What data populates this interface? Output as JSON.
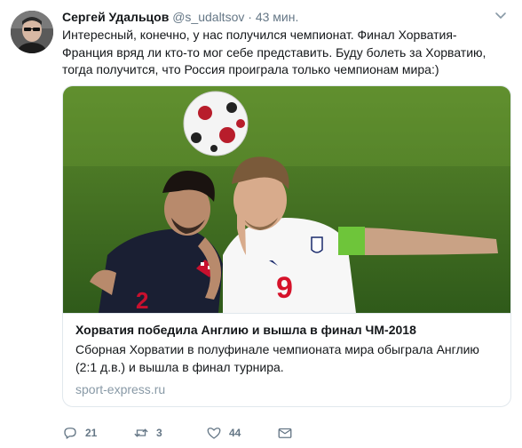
{
  "tweet": {
    "author_name": "Сергей Удальцов",
    "handle": "@s_udaltsov",
    "separator": "·",
    "time": "43 мин.",
    "text": "Интересный, конечно, у нас получился чемпионат. Финал Хорватия-Франция вряд ли кто-то мог себе представить. Буду болеть за Хорватию, тогда получится, что Россия проиграла только чемпионам мира:)"
  },
  "card": {
    "title": "Хорватия победила Англию и вышла в финал ЧМ-2018",
    "description": "Сборная Хорватии в полуфинале чемпионата мира обыграла Англию (2:1 д.в.) и вышла в финал турнира.",
    "domain": "sport-express.ru",
    "image_jersey_number": "9"
  },
  "actions": {
    "reply_count": "21",
    "retweet_count": "3",
    "like_count": "44"
  },
  "icons": {
    "reply": "reply-icon",
    "retweet": "retweet-icon",
    "like": "heart-icon",
    "message": "envelope-icon",
    "menu": "chevron-down-icon"
  },
  "colors": {
    "text": "#14171a",
    "secondary": "#657786",
    "domain": "#8899a6",
    "border": "#e1e8ed"
  }
}
